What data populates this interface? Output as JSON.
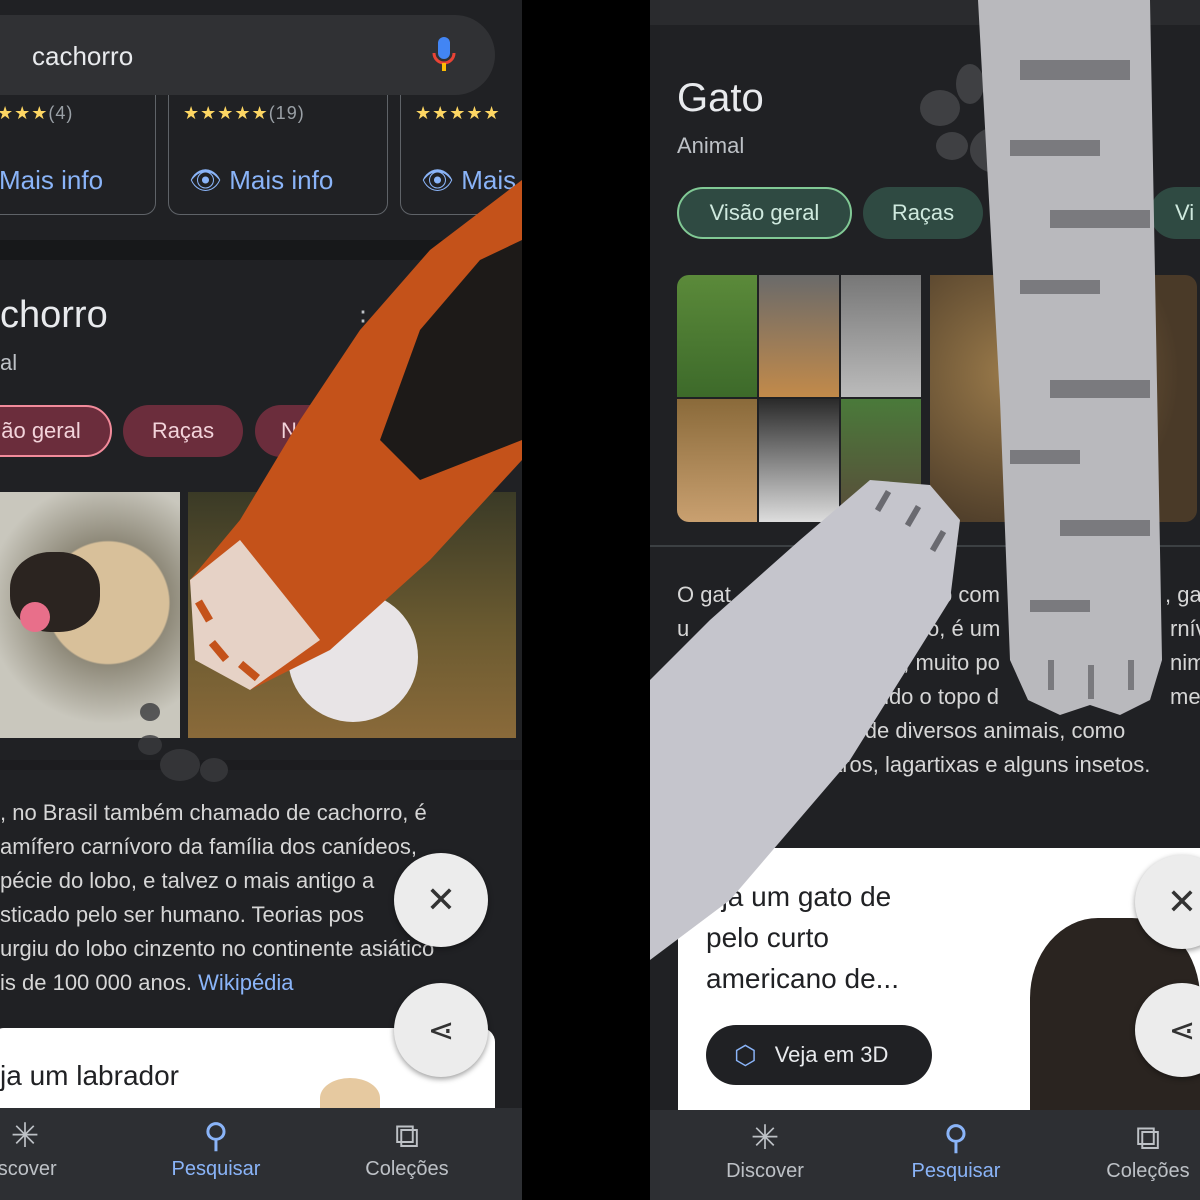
{
  "left": {
    "search": {
      "value": "cachorro",
      "mic_icon": "mic-icon"
    },
    "ratings": [
      {
        "stars": "★★★",
        "count": "(4)"
      },
      {
        "stars": "★★★★★",
        "count": "(19)"
      },
      {
        "stars": "★★★★★",
        "count": ""
      }
    ],
    "more_info": [
      "Mais info",
      "Mais info",
      "Mais"
    ],
    "title": "chorro",
    "subtitle": "al",
    "chips": [
      "ão geral",
      "Raças",
      "No"
    ],
    "description": [
      ", no Brasil também chamado de cachorro, é",
      "amífero carnívoro da família dos canídeos,",
      "pécie do lobo, e talvez o mais antigo a",
      "sticado pelo ser humano. Teorias pos",
      "urgiu do lobo cinzento no continente asiático",
      "is de 100 000 anos."
    ],
    "source_link": "Wikipédia",
    "card_title": "ja um labrador",
    "nav": [
      {
        "label": "iscover",
        "icon": "asterisk-icon"
      },
      {
        "label": "Pesquisar",
        "icon": "search-icon"
      },
      {
        "label": "Coleções",
        "icon": "bookmarks-icon"
      }
    ]
  },
  "right": {
    "title": "Gato",
    "subtitle": "Animal",
    "chips": [
      "Visão geral",
      "Raças",
      "Vi"
    ],
    "description": [
      [
        "O gat",
        "o com",
        ", ga"
      ],
      [
        "u",
        "tico, é um",
        "rnív"
      ],
      [
        "os, muito po",
        "nim"
      ],
      [
        "upando o topo d",
        "men"
      ],
      [
        "ural de diversos animais, como"
      ],
      [
        "ssaros, lagartixas e alguns insetos."
      ]
    ],
    "card_title": [
      "eja um gato de",
      "pelo curto",
      "americano de..."
    ],
    "view_3d": "Veja em 3D",
    "nav": [
      {
        "label": "Discover",
        "icon": "asterisk-icon"
      },
      {
        "label": "Pesquisar",
        "icon": "search-icon"
      },
      {
        "label": "Coleções",
        "icon": "bookmarks-icon"
      }
    ]
  },
  "colors": {
    "background": "#202124",
    "accent": "#8ab4f8",
    "chip_pink": "#6b2d3c",
    "chip_green": "#2f4a42",
    "paw_orange": "#c4521a",
    "paw_gray": "#bdbdc2"
  }
}
